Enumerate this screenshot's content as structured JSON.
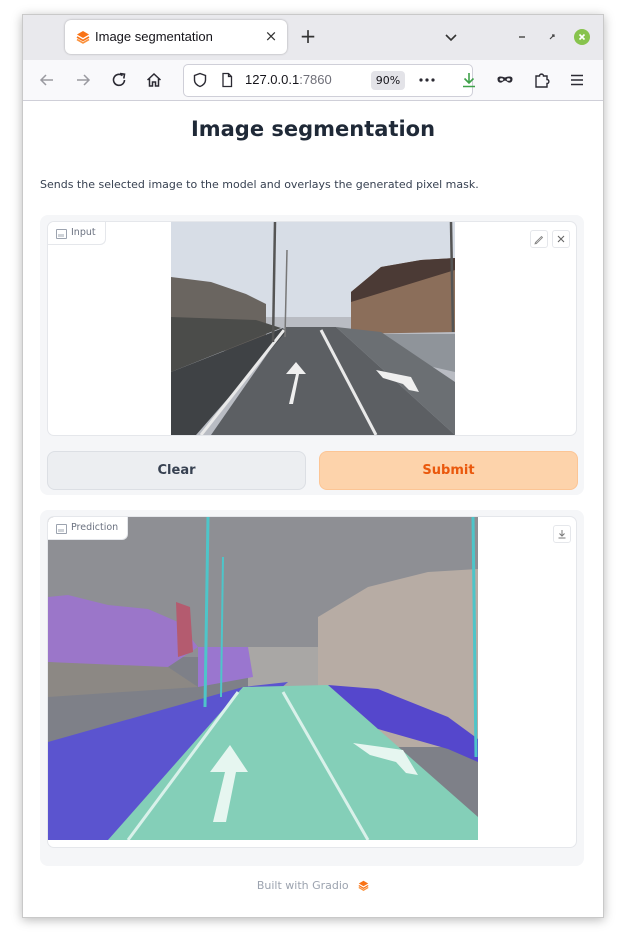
{
  "browser": {
    "tab_title": "Image segmentation",
    "url_host": "127.0.0.1",
    "url_port": ":7860",
    "zoom": "90%",
    "new_tab_symbol": "+",
    "tab_close_symbol": "×"
  },
  "app": {
    "title": "Image segmentation",
    "description": "Sends the selected image to the model and overlays the generated pixel mask.",
    "input_label": "Input",
    "prediction_label": "Prediction",
    "clear_label": "Clear",
    "submit_label": "Submit",
    "footer_text": "Built with Gradio"
  },
  "colors": {
    "accent": "#f97316",
    "submit_bg": "#fdd3ab",
    "submit_text": "#ea580c",
    "road_mask": "#7fd6bd",
    "sidewalk_mask": "#5b4fd6",
    "vegetation_mask": "#9b6fd6"
  },
  "icons": {
    "tab_favicon": "gradio-logo-icon",
    "back": "arrow-left-icon",
    "forward": "arrow-right-icon",
    "reload": "reload-icon",
    "home": "home-icon",
    "shield": "shield-icon",
    "page": "page-icon",
    "more": "more-dots-icon",
    "download": "download-icon",
    "private": "mask-icon",
    "extensions": "puzzle-icon",
    "menu": "hamburger-menu-icon",
    "edit": "pencil-icon",
    "close": "close-icon"
  }
}
